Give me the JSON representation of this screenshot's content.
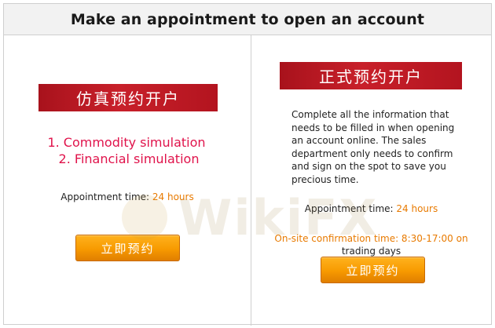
{
  "header": {
    "title": "Make an appointment to open an account"
  },
  "left_panel": {
    "banner": "仿真预约开户",
    "items": [
      "1. Commodity simulation",
      "2. Financial simulation"
    ],
    "appointment_label": "Appointment time:",
    "appointment_value": "24 hours",
    "button_label": "立即预约"
  },
  "right_panel": {
    "banner": "正式预约开户",
    "description": "Complete all the information that needs to be filled in when opening an account online. The sales department only needs to confirm and sign on the spot to save you precious time.",
    "appointment_label": "Appointment time:",
    "appointment_value": "24 hours",
    "onsite_line1": "On-site confirmation time: 8:30-17:00 on",
    "onsite_line2": "trading days",
    "button_label": "立即预约"
  },
  "watermark": {
    "text": "WikiFX"
  },
  "colors": {
    "banner_red": "#b3141f",
    "button_orange": "#f79a00",
    "link_pink": "#e0134b",
    "accent_orange": "#e87a00"
  }
}
